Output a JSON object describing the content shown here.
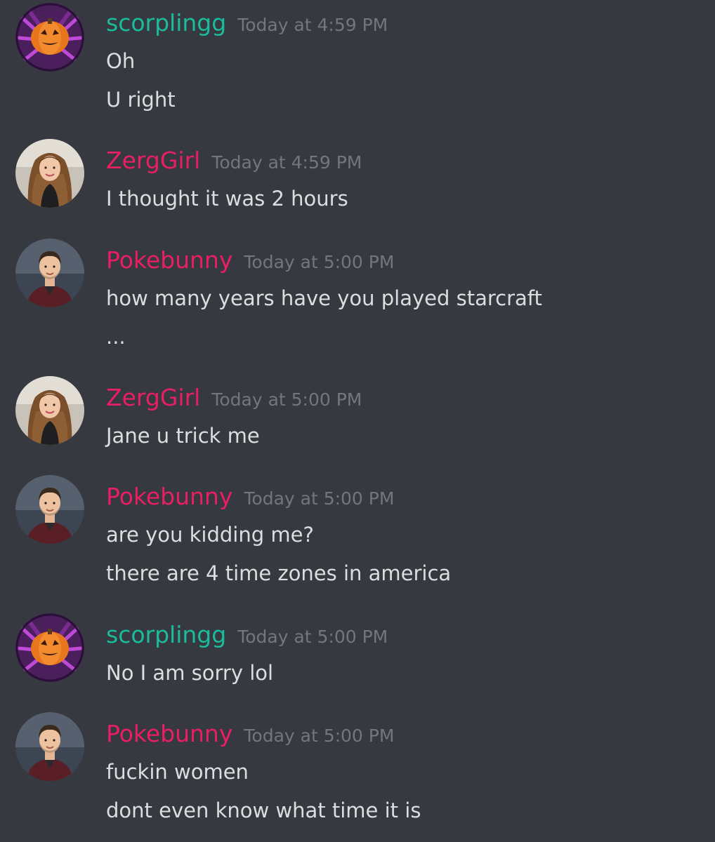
{
  "colors": {
    "background": "#36393f",
    "message_text": "#dcddde",
    "timestamp": "#72767d",
    "scorplingg": "#1abc9c",
    "pink_role": "#e91e63"
  },
  "messages": [
    {
      "author": "scorplingg",
      "author_color": "#1abc9c",
      "avatar_icon": "pumpkin-spider-icon",
      "timestamp": "Today at 4:59 PM",
      "lines": [
        "Oh",
        "U right"
      ]
    },
    {
      "author": "ZergGirl",
      "author_color": "#e91e63",
      "avatar_icon": "woman-portrait-icon",
      "timestamp": "Today at 4:59 PM",
      "lines": [
        "I thought it was 2 hours"
      ]
    },
    {
      "author": "Pokebunny",
      "author_color": "#e91e63",
      "avatar_icon": "man-portrait-icon",
      "timestamp": "Today at 5:00 PM",
      "lines": [
        "how many years have you played starcraft",
        "..."
      ]
    },
    {
      "author": "ZergGirl",
      "author_color": "#e91e63",
      "avatar_icon": "woman-portrait-icon",
      "timestamp": "Today at 5:00 PM",
      "lines": [
        "Jane u trick me"
      ]
    },
    {
      "author": "Pokebunny",
      "author_color": "#e91e63",
      "avatar_icon": "man-portrait-icon",
      "timestamp": "Today at 5:00 PM",
      "lines": [
        "are you kidding me?",
        "there are 4 time zones in america"
      ]
    },
    {
      "author": "scorplingg",
      "author_color": "#1abc9c",
      "avatar_icon": "pumpkin-spider-icon",
      "timestamp": "Today at 5:00 PM",
      "lines": [
        "No I am sorry lol"
      ]
    },
    {
      "author": "Pokebunny",
      "author_color": "#e91e63",
      "avatar_icon": "man-portrait-icon",
      "timestamp": "Today at 5:00 PM",
      "lines": [
        "fuckin women",
        "dont even know what time it is"
      ]
    }
  ]
}
